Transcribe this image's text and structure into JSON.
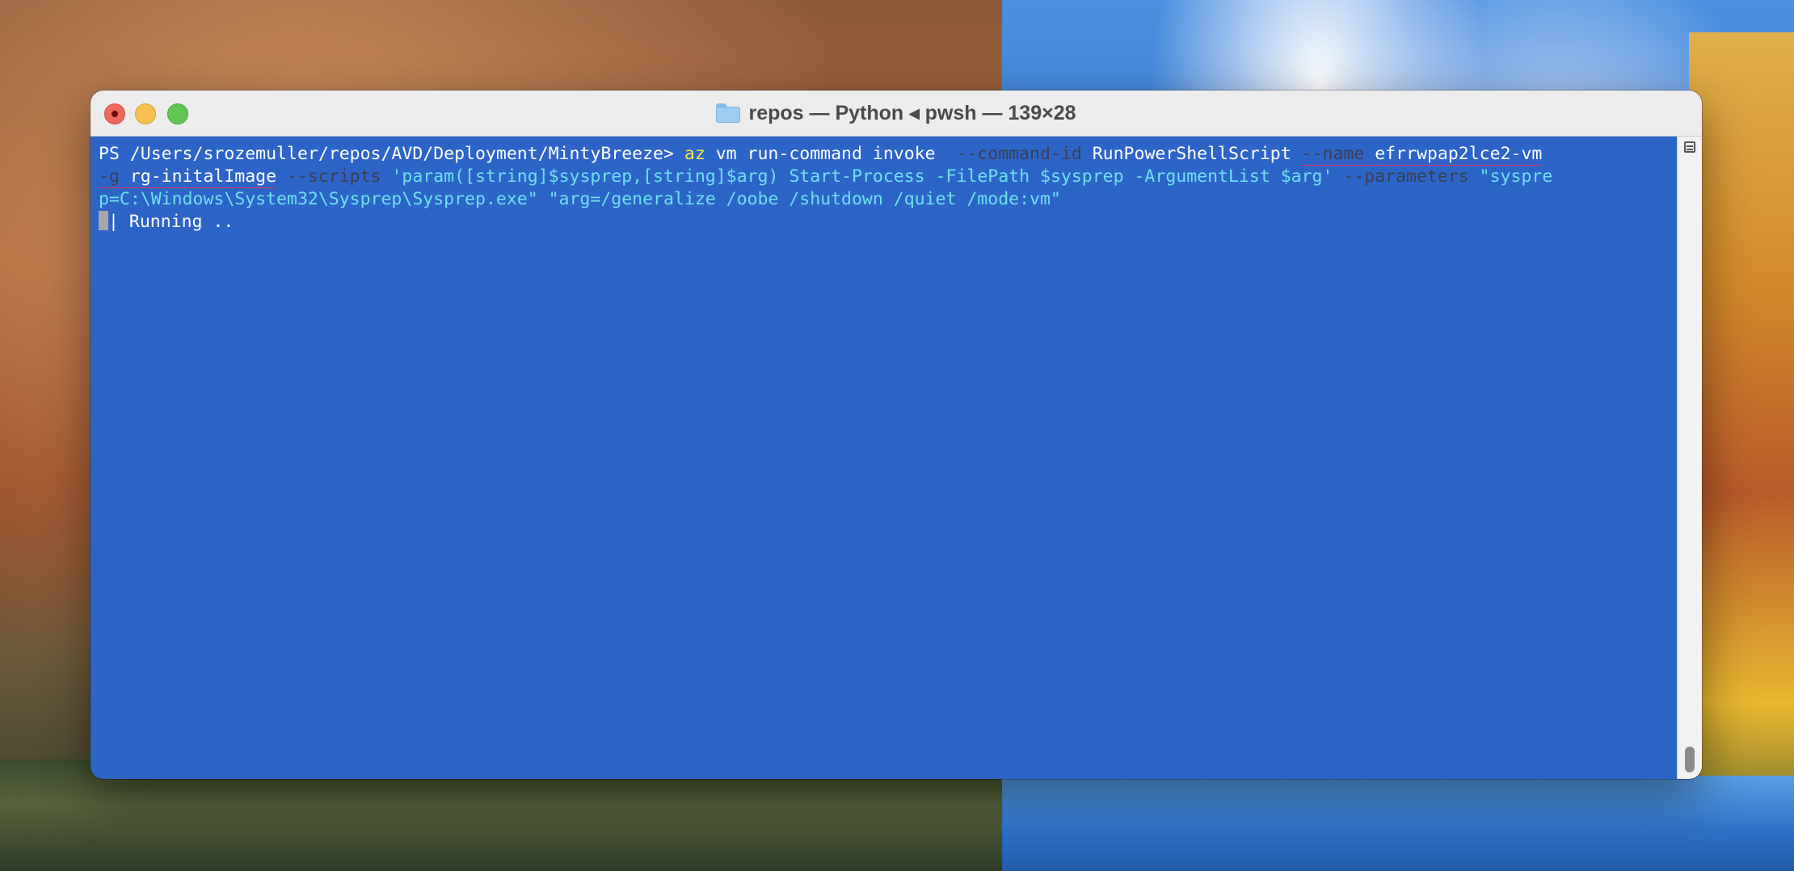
{
  "window": {
    "title": "repos — Python ◂ pwsh — 139×28",
    "folder_icon": "folder-icon"
  },
  "terminal": {
    "line1": {
      "prompt": "PS /Users/srozemuller/repos/AVD/Deployment/MintyBreeze> ",
      "az": "az",
      "cmd": " vm run-command invoke  ",
      "flag_command_id": "--command-id",
      "command_id_value": " RunPowerShellScript ",
      "flag_name": "--name",
      "name_value": " efrrwpap2lce2-vm"
    },
    "line2": {
      "flag_g": "-g",
      "g_value": " rg-initalImage",
      "flag_scripts": " --scripts",
      "scripts_value": " 'param([string]$sysprep,[string]$arg) Start-Process -FilePath $sysprep -ArgumentList $arg'",
      "flag_parameters": " --parameters",
      "parameters_start": " \"syspre"
    },
    "line3": {
      "text": "p=C:\\Windows\\System32\\Sysprep\\Sysprep.exe\" \"arg=/generalize /oobe /shutdown /quiet /mode:vm\""
    },
    "line4": {
      "status": "| Running .."
    }
  },
  "colors": {
    "terminal_bg": "#2d64c8",
    "az_yellow": "#f4e64a",
    "param_cyan": "#6ee0ee",
    "flag_dim": "#3b3f52",
    "underline_red": "#e8325a"
  }
}
